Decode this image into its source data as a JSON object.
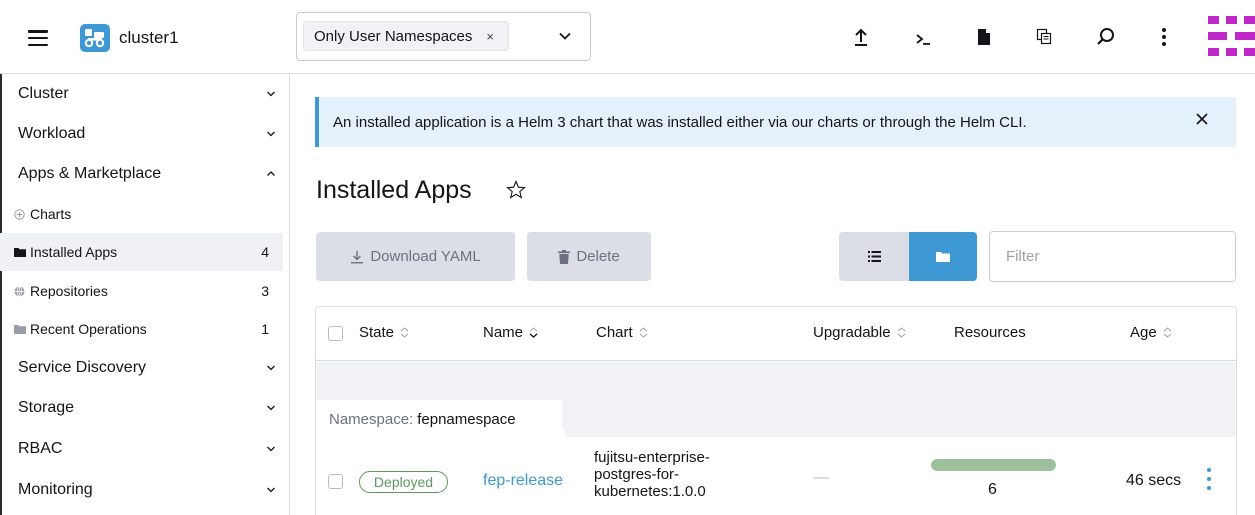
{
  "header": {
    "cluster_name": "cluster1",
    "namespace_chip": "Only User Namespaces",
    "chip_remove": "×",
    "brand_color": "#c027c9",
    "icons": [
      "import-yaml-icon",
      "kubectl-shell-icon",
      "kubeconfig-file-icon",
      "copy-kubeconfig-icon",
      "search-icon",
      "more-menu-icon"
    ]
  },
  "sidebar": {
    "groups": {
      "cluster": "Cluster",
      "workload": "Workload",
      "apps": "Apps & Marketplace",
      "service_discovery": "Service Discovery",
      "storage": "Storage",
      "rbac": "RBAC",
      "monitoring": "Monitoring"
    },
    "items": [
      {
        "label": "Charts",
        "count": ""
      },
      {
        "label": "Installed Apps",
        "count": "4"
      },
      {
        "label": "Repositories",
        "count": "3"
      },
      {
        "label": "Recent Operations",
        "count": "1"
      }
    ]
  },
  "banner": {
    "text": "An installed application is a Helm 3 chart that was installed either via our charts or through the Helm CLI."
  },
  "main": {
    "title": "Installed Apps",
    "download_label": "Download YAML",
    "delete_label": "Delete",
    "filter_placeholder": "Filter",
    "accent": "#3d98d3"
  },
  "table": {
    "headers": {
      "state": "State",
      "name": "Name",
      "chart": "Chart",
      "upgradable": "Upgradable",
      "resources": "Resources",
      "age": "Age"
    },
    "group": {
      "prefix": "Namespace:",
      "name": "fepnamespace"
    },
    "rows": [
      {
        "state": "Deployed",
        "name": "fep-release",
        "chart_lines": [
          "fujitsu-enterprise-",
          "postgres-for-",
          "kubernetes:1.0.0"
        ],
        "upgradable": "—",
        "resources": "6",
        "resources_ready_fraction": 1.0,
        "age": "46 secs"
      }
    ]
  }
}
